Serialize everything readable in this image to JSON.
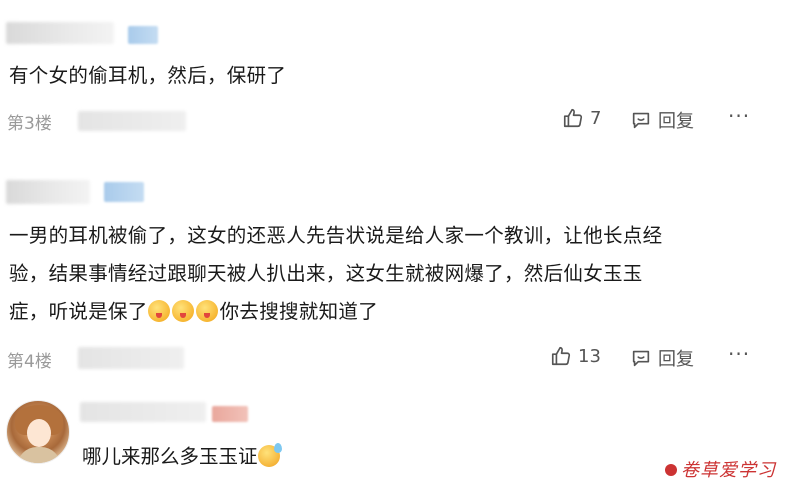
{
  "comments": [
    {
      "text": "有个女的偷耳机，然后，保研了",
      "floor": "第3楼",
      "likes": "7",
      "reply_label": "回复",
      "more_label": "···"
    },
    {
      "text_line1": "一男的耳机被偷了，这女的还恶人先告状说是给人家一个教训，让他长点经",
      "text_line2": "验，结果事情经过跟聊天被人扒出来，这女生就被网爆了，然后仙女玉玉",
      "text_line3_before": "症，听说是保了",
      "text_line3_after": "你去搜搜就知道了",
      "floor": "第4楼",
      "likes": "13",
      "reply_label": "回复",
      "more_label": "···"
    }
  ],
  "sub_comment": {
    "text": "哪儿来那么多玉玉证"
  },
  "watermark": {
    "text": "卷草爱学习"
  },
  "icons": {
    "like": "thumbs-up-icon",
    "reply": "comment-bubble-icon",
    "emoji_tongue": "yummy-face-emoji-icon",
    "emoji_sweat": "sweat-face-emoji-icon"
  }
}
